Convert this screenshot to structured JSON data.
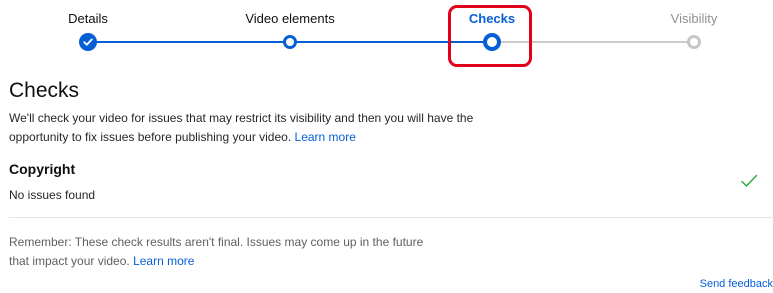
{
  "stepper": {
    "steps": [
      {
        "label": "Details",
        "state": "done"
      },
      {
        "label": "Video elements",
        "state": "visited"
      },
      {
        "label": "Checks",
        "state": "current"
      },
      {
        "label": "Visibility",
        "state": "future"
      }
    ],
    "highlighted_step": "Checks"
  },
  "colors": {
    "accent": "#065fd4",
    "highlight": "#e2001a",
    "success": "#2ba640",
    "inactive": "#c6c6c6"
  },
  "checks": {
    "title": "Checks",
    "intro_text": "We'll check your video for issues that may restrict its visibility and then you will have the opportunity to fix issues before publishing your video.",
    "intro_link": "Learn more"
  },
  "copyright": {
    "title": "Copyright",
    "status": "No issues found",
    "status_icon": "check-icon"
  },
  "reminder": {
    "text": "Remember: These check results aren't final. Issues may come up in the future that impact your video.",
    "link": "Learn more"
  },
  "footer": {
    "send_feedback": "Send feedback"
  }
}
